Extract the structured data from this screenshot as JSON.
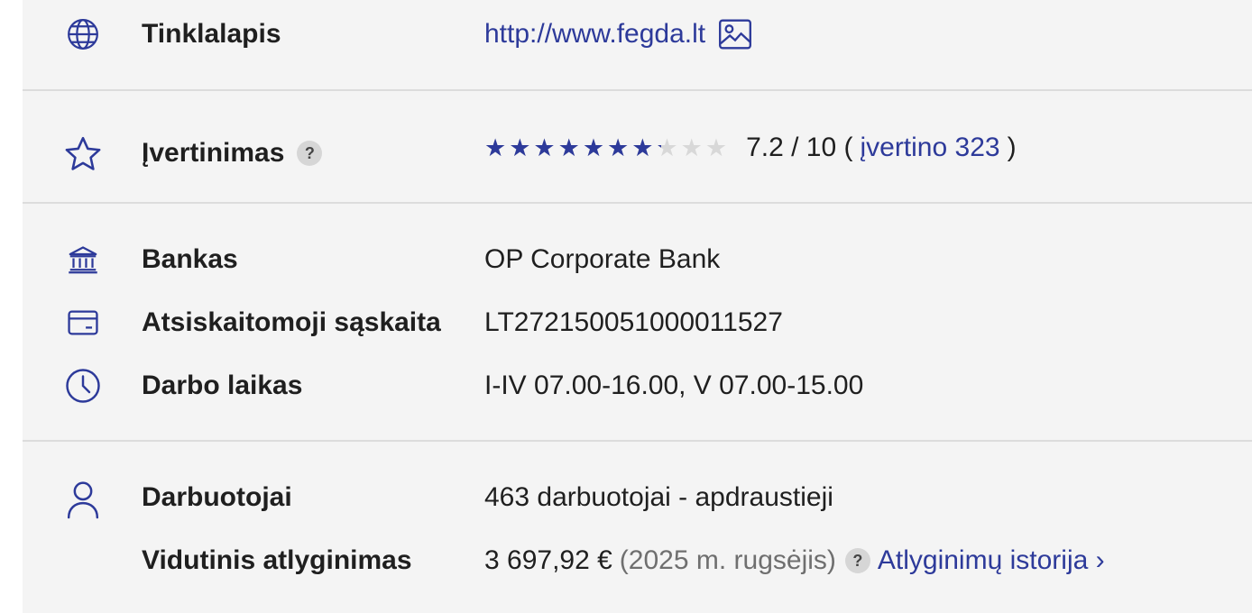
{
  "accent_color": "#2d3a9a",
  "website": {
    "icon": "globe-icon",
    "label": "Tinklalapis",
    "url_text": "http://www.fegda.lt",
    "screenshot_icon": "image-icon"
  },
  "rating": {
    "icon": "star-outline-icon",
    "label": "Įvertinimas",
    "help": "?",
    "stars_glyphs": "★★★★★★★★★★",
    "value": 7.2,
    "max": 10,
    "score_text": "7.2 / 10 (",
    "votes_link": "įvertino 323",
    "close_paren": ")"
  },
  "bank": {
    "icon": "bank-icon",
    "label": "Bankas",
    "value": "OP Corporate Bank"
  },
  "account": {
    "icon": "credit-card-icon",
    "label": "Atsiskaitomoji sąskaita",
    "value": "LT272150051000011527"
  },
  "hours": {
    "icon": "clock-icon",
    "label": "Darbo laikas",
    "value": "I-IV 07.00-16.00, V 07.00-15.00"
  },
  "employees": {
    "icon": "user-icon",
    "label": "Darbuotojai",
    "value": "463 darbuotojai - apdraustieji"
  },
  "salary": {
    "label": "Vidutinis atlyginimas",
    "amount": "3 697,92 €",
    "period": "(2025 m. rugsėjis)",
    "help": "?",
    "history_link": "Atlyginimų istorija ›"
  }
}
